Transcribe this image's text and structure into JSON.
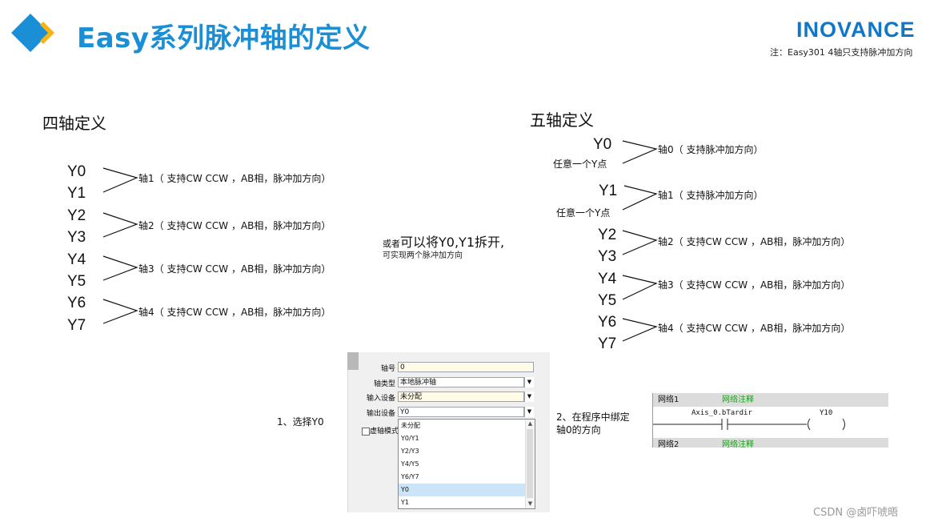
{
  "header": {
    "title": "Easy系列脉冲轴的定义",
    "brand": "INOVANCE",
    "note": "注：Easy301 4轴只支持脉冲加方向"
  },
  "colors": {
    "title": "#1a8fd6",
    "brand": "#1176c8",
    "logo_dark": "#1a8fd6",
    "logo_light": "#f7b417"
  },
  "left_section": {
    "heading": "四轴定义",
    "groups": [
      {
        "y": [
          "Y0",
          "Y1"
        ],
        "axis": "轴1（ 支持CW CCW ，AB相，脉冲加方向）"
      },
      {
        "y": [
          "Y2",
          "Y3"
        ],
        "axis": "轴2（ 支持CW CCW ，AB相，脉冲加方向）"
      },
      {
        "y": [
          "Y4",
          "Y5"
        ],
        "axis": "轴3（ 支持CW CCW ，AB相，脉冲加方向）"
      },
      {
        "y": [
          "Y6",
          "Y7"
        ],
        "axis": "轴4（ 支持CW CCW ，AB相，脉冲加方向）"
      }
    ]
  },
  "middle_note": {
    "prefix": "或者",
    "main": "可以将Y0,Y1拆开,",
    "sub": "可实现两个脉冲加方向"
  },
  "right_section": {
    "heading": "五轴定义",
    "single": [
      {
        "y": "Y0",
        "note": "任意一个Y点",
        "axis": "轴0（ 支持脉冲加方向）"
      },
      {
        "y": "Y1",
        "note": "任意一个Y点",
        "axis": "轴1（ 支持脉冲加方向）"
      }
    ],
    "groups": [
      {
        "y": [
          "Y2",
          "Y3"
        ],
        "axis": "轴2（ 支持CW CCW ，AB相，脉冲加方向）"
      },
      {
        "y": [
          "Y4",
          "Y5"
        ],
        "axis": "轴3（ 支持CW CCW ，AB相，脉冲加方向）"
      },
      {
        "y": [
          "Y6",
          "Y7"
        ],
        "axis": "轴4（ 支持CW CCW ，AB相，脉冲加方向）"
      }
    ]
  },
  "config_dialog": {
    "caption": "1、选择Y0",
    "fields": [
      {
        "label": "轴号",
        "value": "0"
      },
      {
        "label": "轴类型",
        "value": "本地脉冲轴"
      },
      {
        "label": "输入设备",
        "value": "未分配"
      },
      {
        "label": "输出设备",
        "value": "Y0"
      }
    ],
    "virtual_label": "虚轴模式",
    "options": [
      "未分配",
      "Y0/Y1",
      "Y2/Y3",
      "Y4/Y5",
      "Y6/Y7",
      "Y0",
      "Y1"
    ],
    "selected": "Y0"
  },
  "ladder": {
    "caption": "2、在程序中绑定轴0的方向",
    "network1": "网络1",
    "network1_comment": "网络注释",
    "contact": "Axis_0.bTardir",
    "coil": "Y10",
    "network2": "网络2",
    "network2_comment": "网络注释"
  },
  "watermark": "CSDN @卤吓唬晤"
}
